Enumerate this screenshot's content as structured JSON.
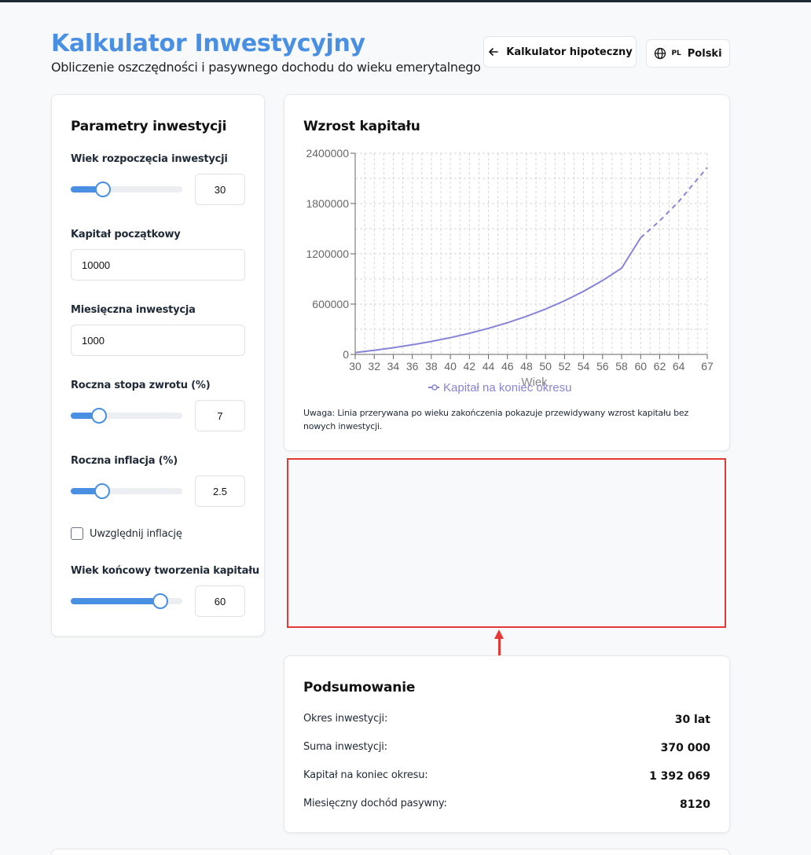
{
  "header": {
    "title": "Kalkulator Inwestycyjny",
    "subtitle": "Obliczenie oszczędności i pasywnego dochodu do wieku emerytalnego",
    "mortgage_button": "Kalkulator hipoteczny",
    "lang_code": "PL",
    "lang_label": "Polski"
  },
  "params": {
    "title": "Parametry inwestycji",
    "start_age": {
      "label": "Wiek rozpoczęcia inwestycji",
      "value": "30",
      "slider_fraction": 0.29
    },
    "initial_capital": {
      "label": "Kapitał początkowy",
      "value": "10000"
    },
    "monthly_investment": {
      "label": "Miesięczna inwestycja",
      "value": "1000"
    },
    "return_rate": {
      "label": "Roczna stopa zwrotu (%)",
      "value": "7",
      "slider_fraction": 0.25
    },
    "inflation": {
      "label": "Roczna inflacja (%)",
      "value": "2.5",
      "slider_fraction": 0.28
    },
    "include_inflation": {
      "label": "Uwzględnij inflację",
      "checked": false
    },
    "end_age": {
      "label": "Wiek końcowy tworzenia kapitału",
      "value": "60",
      "slider_fraction": 0.8
    }
  },
  "chart": {
    "title": "Wzrost kapitału",
    "note": "Uwaga: Linia przerywana po wieku zakończenia pokazuje przewidywany wzrost kapitału bez nowych inwestycji."
  },
  "chart_data": {
    "type": "line",
    "xlabel": "Wiek",
    "ylabel": "",
    "xlim": [
      30,
      67
    ],
    "ylim": [
      0,
      2400000
    ],
    "x_ticks": [
      "30",
      "32",
      "34",
      "36",
      "38",
      "40",
      "42",
      "44",
      "46",
      "48",
      "50",
      "52",
      "54",
      "56",
      "58",
      "60",
      "62",
      "64",
      "67"
    ],
    "y_ticks": [
      "0",
      "600000",
      "1200000",
      "1800000",
      "2400000"
    ],
    "grid": true,
    "legend_position": "bottom",
    "series": [
      {
        "name": "Kapitał na koniec okresu",
        "color": "#8884d8",
        "x": [
          30,
          32,
          34,
          36,
          38,
          40,
          42,
          44,
          46,
          48,
          50,
          52,
          54,
          56,
          58,
          60
        ],
        "y": [
          22000,
          49000,
          80000,
          115000,
          155000,
          200000,
          252000,
          311000,
          378000,
          454000,
          541000,
          640000,
          753000,
          882000,
          1029000,
          1392069
        ]
      },
      {
        "name": "",
        "color": "#8884d8",
        "dashed": true,
        "x": [
          60,
          62,
          64,
          67
        ],
        "y": [
          1392069,
          1593000,
          1824000,
          2230000
        ]
      }
    ]
  },
  "summary": {
    "title": "Podsumowanie",
    "rows": [
      {
        "label": "Okres inwestycji:",
        "value": "30 lat"
      },
      {
        "label": "Suma inwestycji:",
        "value": "370 000"
      },
      {
        "label": "Kapitał na koniec okresu:",
        "value": "1 392 069"
      },
      {
        "label": "Miesięczny dochód pasywny:",
        "value": "8120"
      }
    ]
  }
}
